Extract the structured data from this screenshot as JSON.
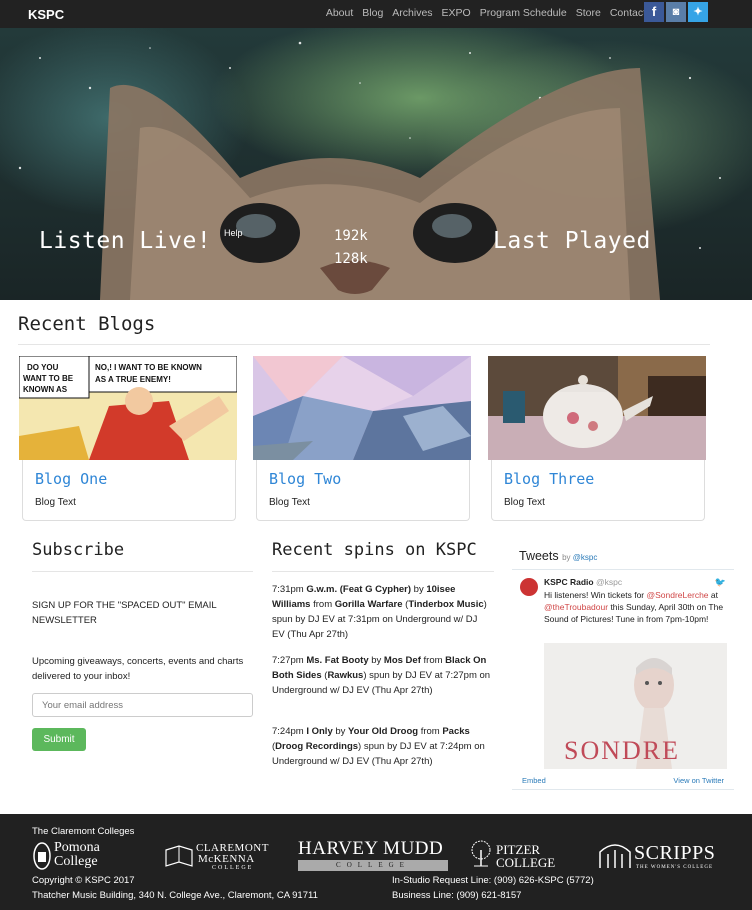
{
  "navbar": {
    "brand": "KSPC",
    "links": [
      "About",
      "Blog",
      "Archives",
      "EXPO",
      "Program Schedule",
      "Store",
      "Contact"
    ],
    "social": [
      "facebook-icon",
      "instagram-icon",
      "twitter-icon"
    ]
  },
  "hero": {
    "listen_live": "Listen Live!",
    "help": "Help",
    "stream_high": "192k",
    "stream_low": "128k",
    "last_played": "Last Played"
  },
  "recent_blogs": {
    "title": "Recent Blogs",
    "cards": [
      {
        "title": "Blog One",
        "text": "Blog Text"
      },
      {
        "title": "Blog Two",
        "text": "Blog Text"
      },
      {
        "title": "Blog Three",
        "text": "Blog Text"
      }
    ]
  },
  "subscribe": {
    "title": "Subscribe",
    "signup": "SIGN UP FOR THE \"SPACED OUT\" EMAIL NEWSLETTER",
    "upcoming": "Upcoming giveaways, concerts, events and charts delivered to your inbox!",
    "email_placeholder": "Your email address",
    "submit": "Submit"
  },
  "spins": {
    "title": "Recent spins on KSPC",
    "items": [
      {
        "time": "7:31pm",
        "song": "G.w.m. (Feat G Cypher)",
        "artist": "10isee Williams",
        "album": "Gorilla Warfare",
        "label": "Tinderbox Music",
        "tail": "spun by DJ EV at 7:31pm on Underground w/ DJ EV (Thu Apr 27th)"
      },
      {
        "time": "7:27pm",
        "song": "Ms. Fat Booty",
        "artist": "Mos Def",
        "album": "Black On Both Sides",
        "label": "Rawkus",
        "tail": "spun by DJ EV at 7:27pm on Underground w/ DJ EV (Thu Apr 27th)"
      },
      {
        "time": "7:24pm",
        "song": "I Only",
        "artist": "Your Old Droog",
        "album": "Packs",
        "label": "Droog Recordings",
        "tail": "spun by DJ EV at 7:24pm on Underground w/ DJ EV (Thu Apr 27th)"
      }
    ]
  },
  "twitter": {
    "title": "Tweets",
    "by": "by",
    "handle": "@kspc",
    "name": "KSPC Radio",
    "screen_name": "@kspc",
    "tweet_pre": "Hi listeners! Win tickets for ",
    "mention1": "@SondreLerche",
    "tweet_mid": " at ",
    "mention2": "@theTroubadour",
    "tweet_post": " this Sunday, April 30th on The Sound of Pictures! Tune in from 7pm-10pm!",
    "image_text": "SONDRE",
    "embed": "Embed",
    "view": "View on Twitter"
  },
  "footer": {
    "colleges_title": "The Claremont Colleges",
    "copyright": "Copyright © KSPC 2017",
    "address": "Thatcher Music Building, 340 N. College Ave., Claremont, CA 91711",
    "request_line": "In-Studio Request Line: (909) 626-KSPC (5772)",
    "business_line": "Business Line: (909) 621-8157",
    "logos": {
      "pomona_1": "Pomona",
      "pomona_2": "College",
      "cmc_1": "CLAREMONT",
      "cmc_2": "McKENNA",
      "cmc_3": "COLLEGE",
      "hmc_1": "HARVEY MUDD",
      "hmc_2": "COLLEGE",
      "pitzer_1": "PITZER",
      "pitzer_2": "COLLEGE",
      "scripps_1": "SCRIPPS",
      "scripps_2": "THE WOMEN'S COLLEGE"
    }
  }
}
